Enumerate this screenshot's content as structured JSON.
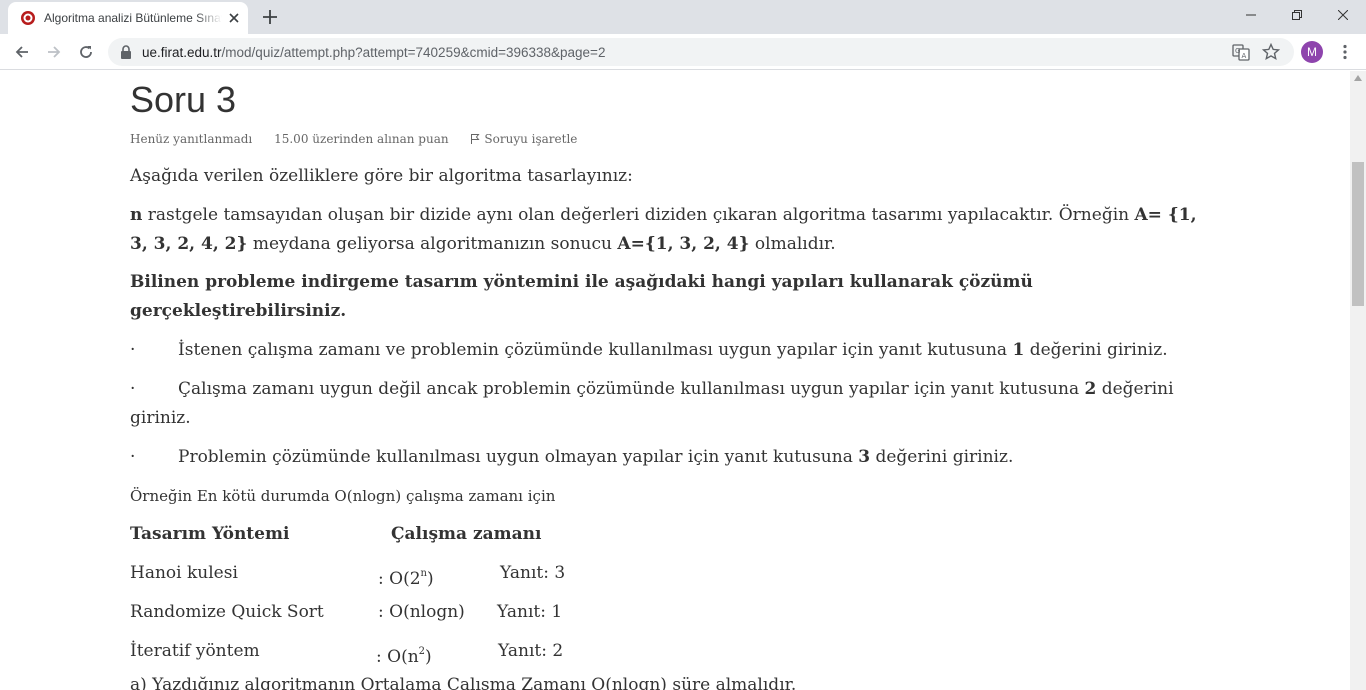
{
  "browser": {
    "tab_title": "Algoritma analizi Bütünleme Sınavı",
    "url_host": "ue.firat.edu.tr",
    "url_path": "/mod/quiz/attempt.php?attempt=740259&cmid=396338&page=2",
    "avatar_letter": "M",
    "accent": "#8e44ad"
  },
  "question": {
    "title": "Soru 3",
    "status": "Henüz yanıtlanmadı",
    "points": "15.00 üzerinden alınan puan",
    "flag_label": "Soruyu işaretle",
    "intro": "Aşağıda verilen özelliklere göre bir algoritma tasarlayınız:",
    "problem": {
      "n": "n",
      "l1a": " rastgele tamsayıdan oluşan bir dizide aynı olan değerleri diziden çıkaran algoritma tasarımı yapılacaktır. Örneğin ",
      "l1b": "A= {1,",
      "l2a": "3, 3, 2, 4, 2}",
      "l2b": " meydana geliyorsa algoritmanızın sonucu ",
      "l2c": "A={1, 3, 2, 4}",
      "l2d": " olmalıdır."
    },
    "instruction_l1": " Bilinen probleme indirgeme tasarım yöntemini ile aşağıdaki hangi yapıları kullanarak çözümü",
    "instruction_l2": "gerçekleştirebilirsiniz.",
    "bullet_char": "·",
    "bullet1": {
      "text": "İstenen çalışma zamanı ve problemin çözümünde kullanılması uygun yapılar için yanıt kutusuna ",
      "num": "1",
      "tail": " değerini giriniz."
    },
    "bullet2": {
      "text": "Çalışma zamanı uygun değil ancak problemin çözümünde kullanılması uygun yapılar için yanıt kutusuna ",
      "num": "2",
      "tail": " değerini",
      "l2": "giriniz."
    },
    "bullet3": {
      "text": "Problemin çözümünde kullanılması uygun olmayan yapılar için yanıt kutusuna ",
      "num": "3",
      "tail": " değerini giriniz."
    },
    "example_intro": "Örneğin En kötü durumda O(nlogn) çalışma zamanı için",
    "table": {
      "headers": [
        "Tasarım Yöntemi",
        "Çalışma zamanı"
      ],
      "rows": [
        {
          "method": "Hanoi kulesi",
          "time_pre": ": O(2",
          "time_sup": "n",
          "time_post": ")",
          "answer": "Yanıt: 3"
        },
        {
          "method": "Randomize Quick Sort",
          "time_pre": ": O(nlogn)",
          "time_sup": "",
          "time_post": "",
          "answer": "Yanıt: 1"
        },
        {
          "method": "İteratif yöntem",
          "time_pre": ": O(n",
          "time_sup": "2",
          "time_post": ")",
          "answer": "Yanıt: 2"
        }
      ]
    },
    "cut_line": "a) Yazdığınız algoritmanın Ortalama Çalışma Zamanı O(nlogn) süre almalıdır."
  }
}
